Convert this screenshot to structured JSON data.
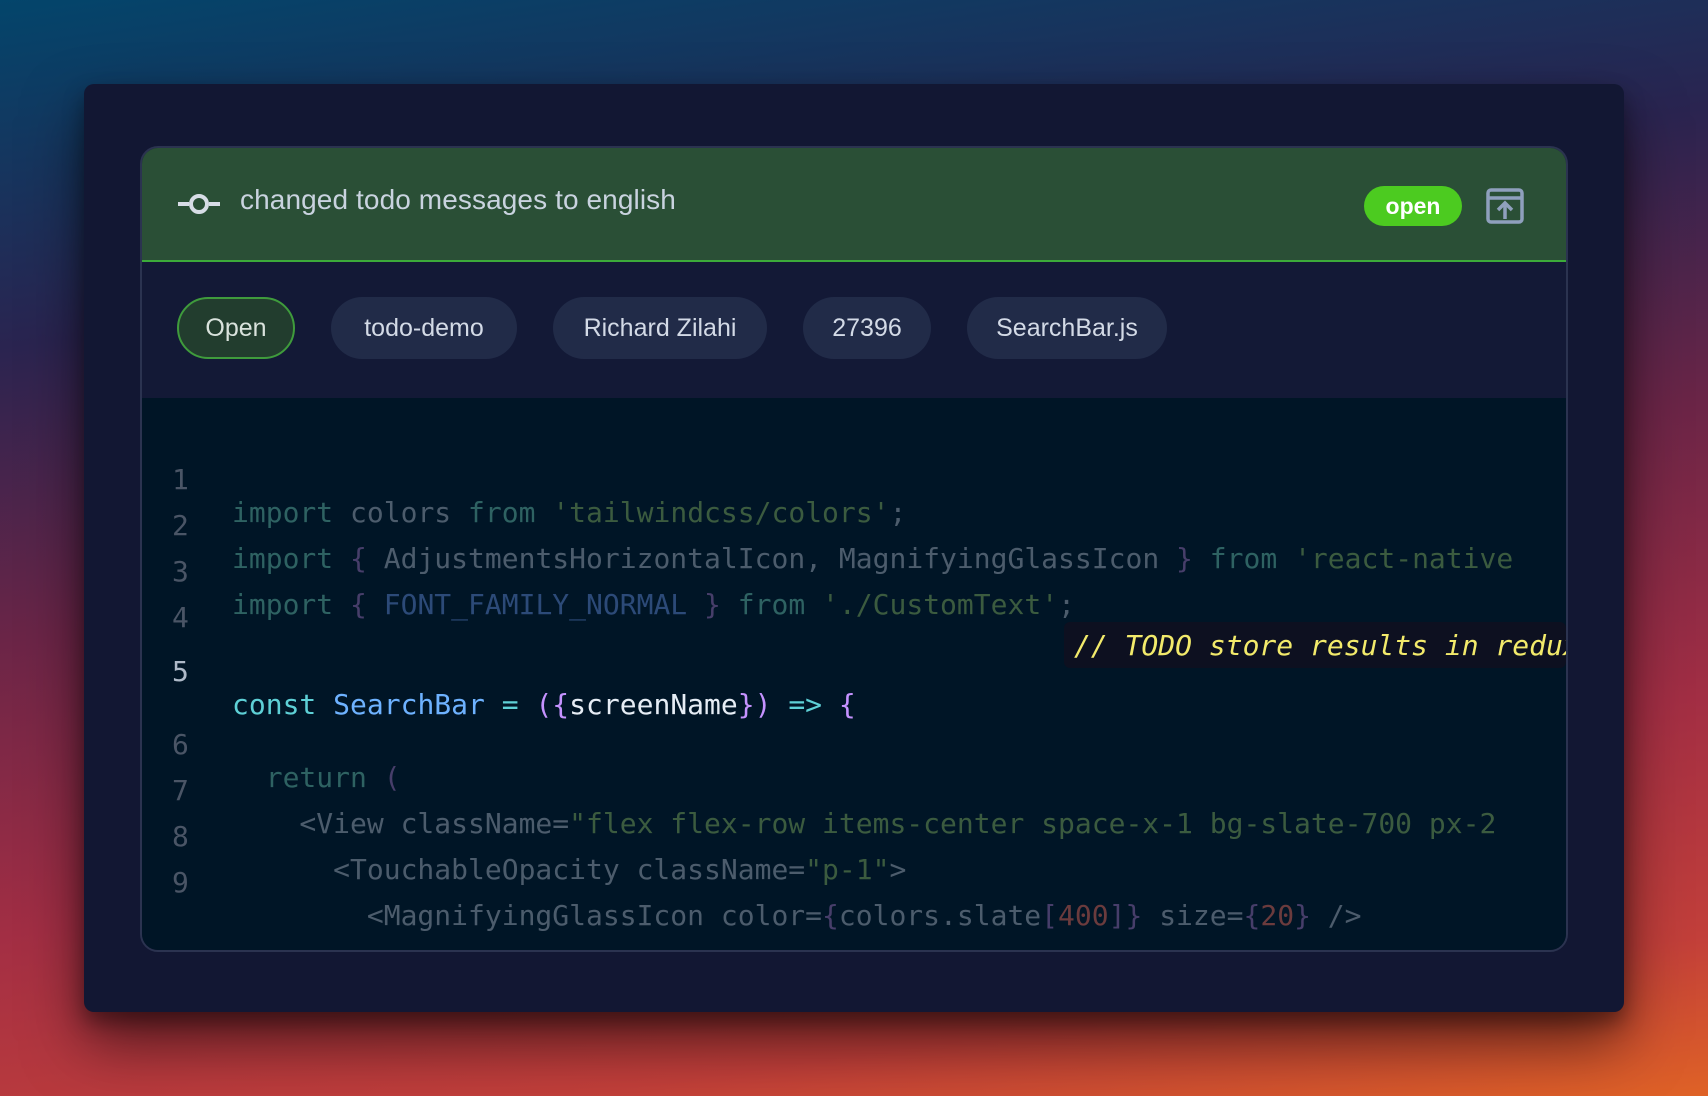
{
  "header": {
    "title": "changed todo messages to english",
    "status_badge": "open",
    "icons": {
      "commit": "git-commit-icon",
      "open_external": "open-in-window-icon"
    }
  },
  "chips": [
    {
      "label": "Open",
      "active": true
    },
    {
      "label": "todo-demo"
    },
    {
      "label": "Richard Zilahi"
    },
    {
      "label": "27396"
    },
    {
      "label": "SearchBar.js"
    }
  ],
  "code": {
    "highlighted_line": 5,
    "lines": [
      {
        "n": "1",
        "text": "import colors from 'tailwindcss/colors';"
      },
      {
        "n": "2",
        "text": "import { AdjustmentsHorizontalIcon, MagnifyingGlassIcon } from 'react-native"
      },
      {
        "n": "3",
        "text": "import { FONT_FAMILY_NORMAL } from './CustomText';"
      },
      {
        "n": "4",
        "text": ""
      },
      {
        "n": "5",
        "text": "const SearchBar = ({screenName}) => {"
      },
      {
        "n": "6",
        "text": "  return ("
      },
      {
        "n": "7",
        "text": "    <View className=\"flex flex-row items-center space-x-1 bg-slate-700 px-2"
      },
      {
        "n": "8",
        "text": "      <TouchableOpacity className=\"p-1\">"
      },
      {
        "n": "9",
        "text": "        <MagnifyingGlassIcon color={colors.slate[400]} size={20} />"
      }
    ],
    "todo_comment": "// TODO store results in redux"
  },
  "colors": {
    "header_bg": "#2a4f36",
    "badge_green": "#4ccb20",
    "todo_text": "#f2ea6b",
    "code_bg": "#001526"
  }
}
